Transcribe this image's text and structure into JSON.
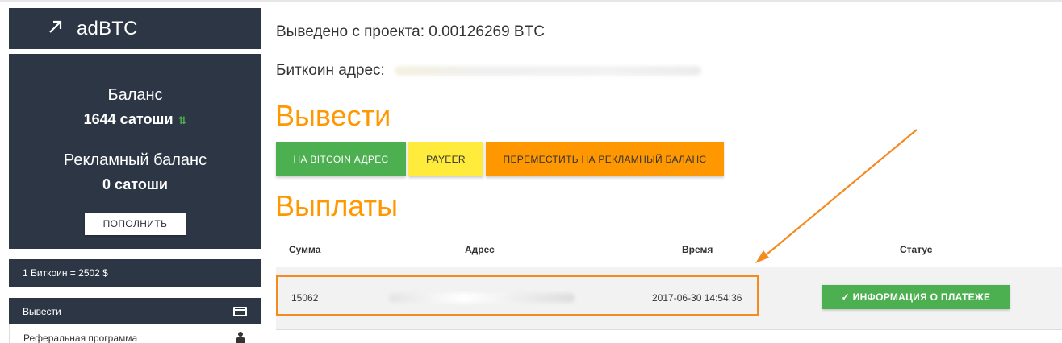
{
  "brand": {
    "name": "adBTC",
    "icon": "trending-arrow-icon"
  },
  "balance": {
    "label": "Баланс",
    "value": "1644 сатоши",
    "ad_label": "Рекламный баланс",
    "ad_value": "0 сатоши",
    "topup_label": "ПОПОЛНИТЬ"
  },
  "rate": {
    "text": "1 Биткоин = 2502 $"
  },
  "menu": {
    "items": [
      {
        "label": "Вывести",
        "icon": "credit-card-icon",
        "active": true
      },
      {
        "label": "Реферальная программа",
        "icon": "people-icon",
        "active": false
      }
    ]
  },
  "main": {
    "withdrawn_text": "Выведено с проекта: 0.00126269 BTC",
    "address_label": "Биткоин адрес:",
    "withdraw_heading": "Вывести",
    "payouts_heading": "Выплаты",
    "buttons": {
      "bitcoin": "НА BITCOIN АДРЕС",
      "payeer": "PAYEER",
      "move": "ПЕРЕМЕСТИТЬ НА РЕКЛАМНЫЙ БАЛАНС"
    }
  },
  "table": {
    "headers": [
      "Сумма",
      "Адрес",
      "Время",
      "Статус"
    ],
    "rows": [
      {
        "amount": "15062",
        "time": "2017-06-30 14:54:36",
        "status_label": "ИНФОРМАЦИЯ О ПЛАТЕЖЕ"
      }
    ]
  },
  "colors": {
    "sidebar": "#2c3645",
    "accent_orange": "#ff9800",
    "green": "#4caf50",
    "yellow": "#ffeb3b",
    "annotation": "#f58a1f"
  }
}
